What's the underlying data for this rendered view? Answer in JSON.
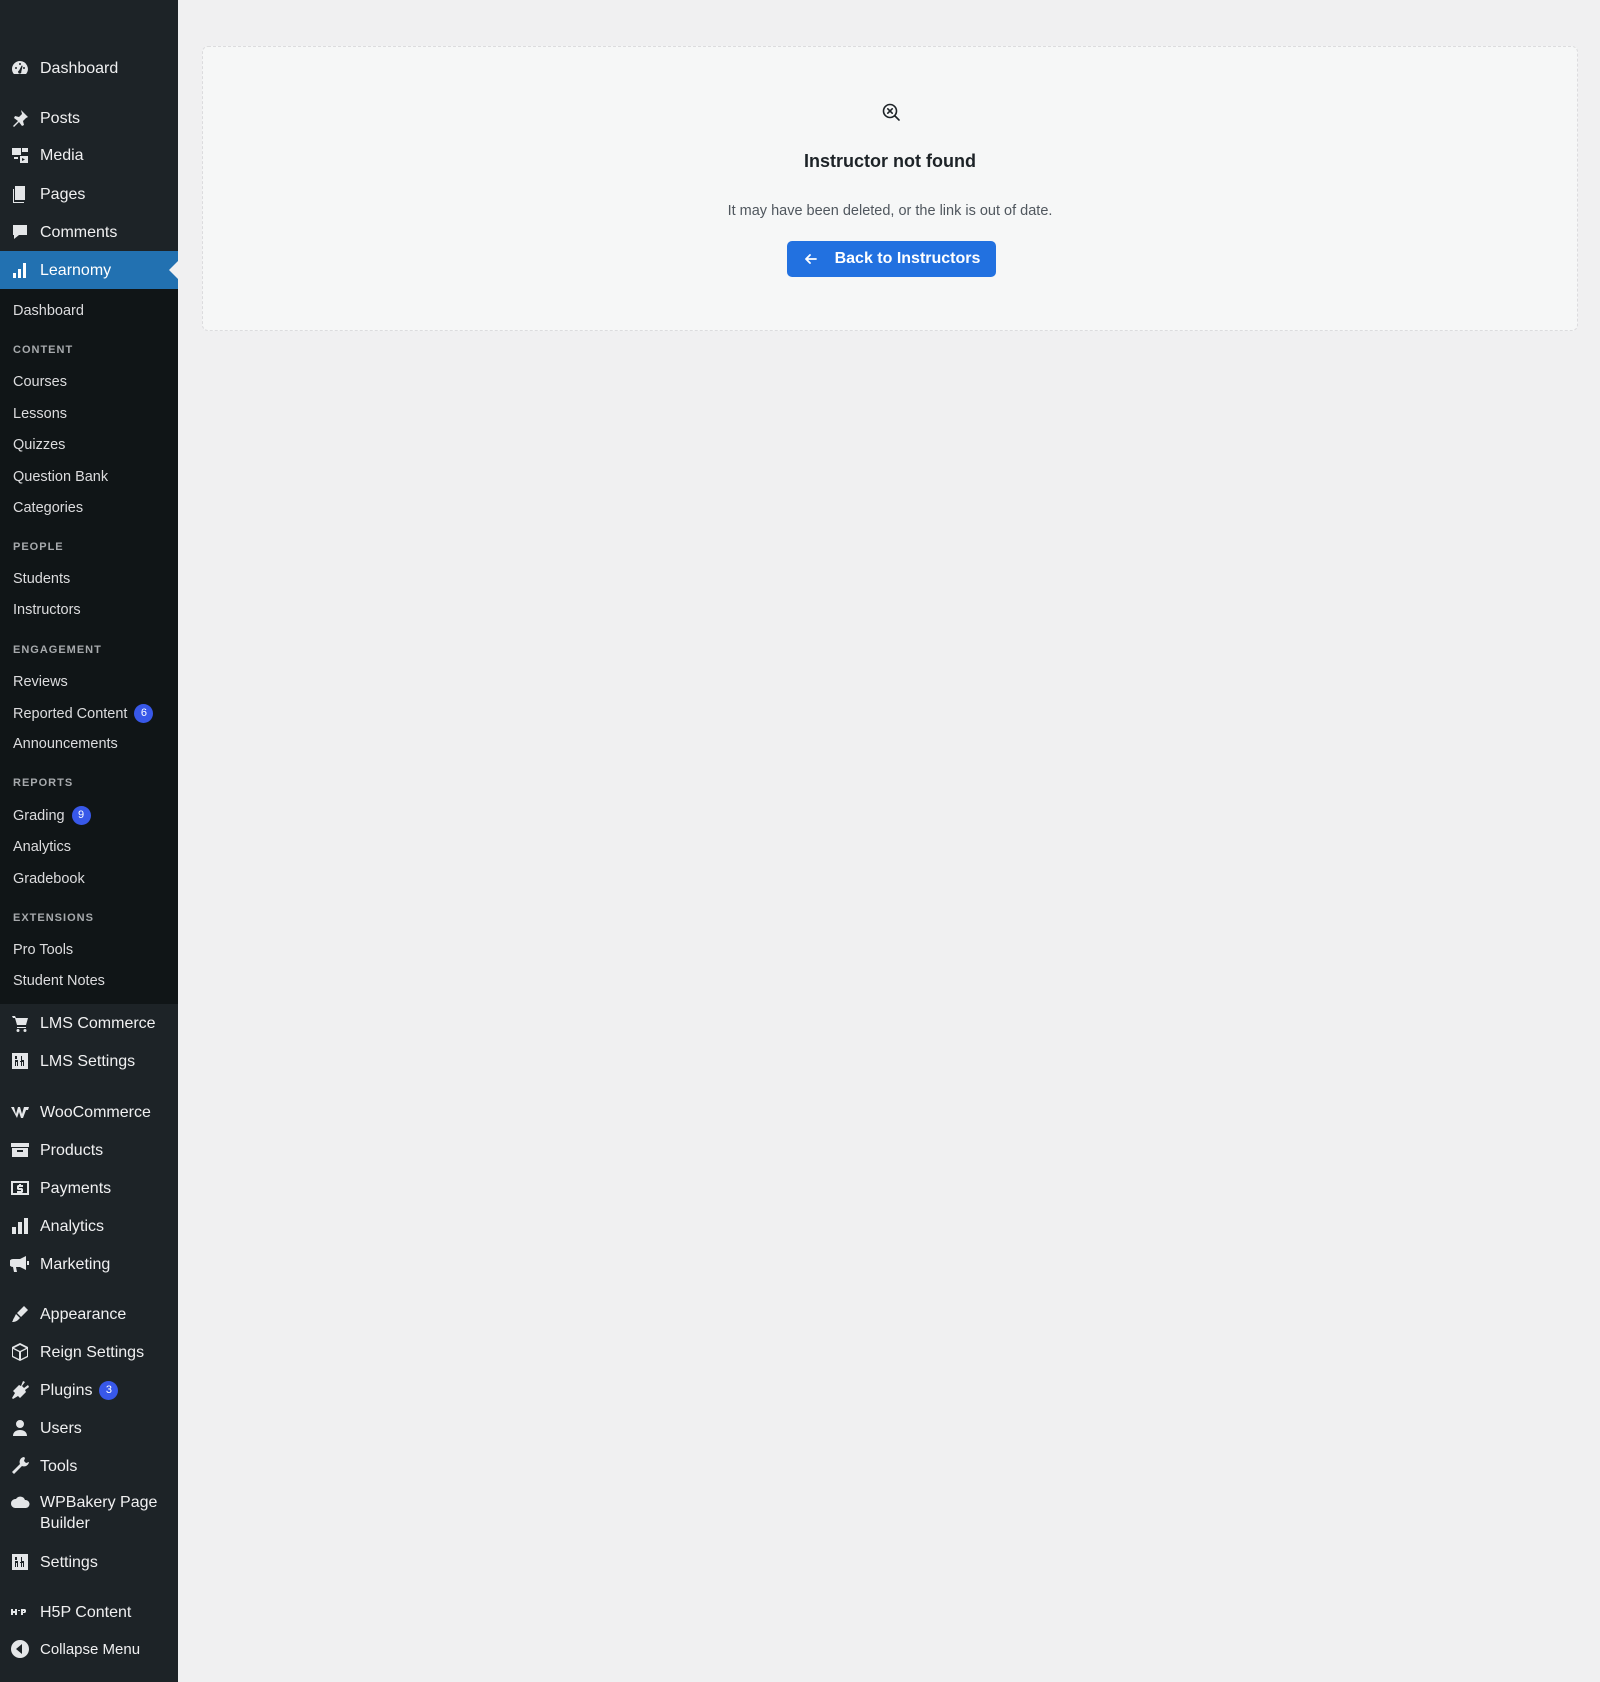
{
  "sidebar": {
    "top_items": [
      {
        "label": "Dashboard",
        "icon": "dashboard-icon"
      },
      {
        "label": "Posts",
        "icon": "pin-icon"
      },
      {
        "label": "Media",
        "icon": "media-icon"
      },
      {
        "label": "Pages",
        "icon": "pages-icon"
      },
      {
        "label": "Comments",
        "icon": "comments-icon"
      },
      {
        "label": "Learnomy",
        "icon": "bar-chart-icon",
        "active": true
      }
    ],
    "learnomy_submenu": {
      "dashboard": "Dashboard",
      "content_heading": "CONTENT",
      "courses": "Courses",
      "lessons": "Lessons",
      "quizzes": "Quizzes",
      "question_bank": "Question Bank",
      "categories": "Categories",
      "people_heading": "PEOPLE",
      "students": "Students",
      "instructors": "Instructors",
      "engagement_heading": "ENGAGEMENT",
      "reviews": "Reviews",
      "reported_content": "Reported Content",
      "reported_content_count": "6",
      "announcements": "Announcements",
      "reports_heading": "REPORTS",
      "grading": "Grading",
      "grading_count": "9",
      "analytics": "Analytics",
      "gradebook": "Gradebook",
      "extensions_heading": "EXTENSIONS",
      "pro_tools": "Pro Tools",
      "student_notes": "Student Notes"
    },
    "bottom_items": [
      {
        "label": "LMS Commerce",
        "icon": "cart-icon"
      },
      {
        "label": "LMS Settings",
        "icon": "settings-grid-icon"
      },
      {
        "label": "WooCommerce",
        "icon": "woocommerce-icon"
      },
      {
        "label": "Products",
        "icon": "archive-icon"
      },
      {
        "label": "Payments",
        "icon": "dollar-icon"
      },
      {
        "label": "Analytics",
        "icon": "bar-chart-icon"
      },
      {
        "label": "Marketing",
        "icon": "megaphone-icon"
      },
      {
        "label": "Appearance",
        "icon": "brush-icon"
      },
      {
        "label": "Reign Settings",
        "icon": "cube-icon"
      },
      {
        "label": "Plugins",
        "icon": "plug-icon",
        "badge": "3"
      },
      {
        "label": "Users",
        "icon": "user-icon"
      },
      {
        "label": "Tools",
        "icon": "wrench-icon"
      },
      {
        "label": "WPBakery Page Builder",
        "icon": "cloud-icon"
      },
      {
        "label": "Settings",
        "icon": "settings-grid-icon"
      },
      {
        "label": "H5P Content",
        "icon": "h5p-icon"
      },
      {
        "label": "Collapse Menu",
        "icon": "collapse-icon"
      }
    ]
  },
  "main": {
    "title": "Instructor not found",
    "description": "It may have been deleted, or the link is out of date.",
    "back_button_label": "Back to Instructors",
    "icon": "search-x-icon"
  },
  "colors": {
    "sidebar_bg": "#1d2327",
    "submenu_bg": "#101517",
    "active_bg": "#2271b1",
    "button_bg": "#2271e0",
    "badge_bg": "#3858e9"
  }
}
